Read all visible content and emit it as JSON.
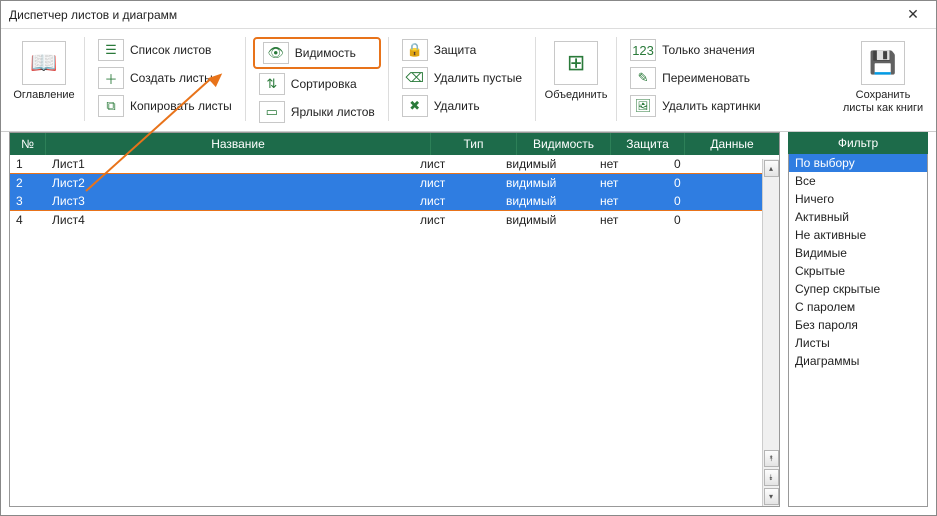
{
  "window": {
    "title": "Диспетчер листов и диаграмм"
  },
  "toolbar": {
    "toc": "Оглавление",
    "list_sheets": "Список листов",
    "create_sheets": "Создать листы",
    "copy_sheets": "Копировать листы",
    "visibility": "Видимость",
    "sort": "Сортировка",
    "tab_labels": "Ярлыки листов",
    "protection": "Защита",
    "delete_empty": "Удалить пустые",
    "delete": "Удалить",
    "merge": "Объединить",
    "values_only": "Только значения",
    "rename": "Переименовать",
    "delete_pictures": "Удалить картинки",
    "save_as_books": "Сохранить\nлисты как книги"
  },
  "table": {
    "headers": {
      "num": "№",
      "name": "Название",
      "type": "Тип",
      "visibility": "Видимость",
      "protection": "Защита",
      "data": "Данные"
    },
    "rows": [
      {
        "num": "1",
        "name": "Лист1",
        "type": "лист",
        "visibility": "видимый",
        "protection": "нет",
        "data": "0",
        "selected": false
      },
      {
        "num": "2",
        "name": "Лист2",
        "type": "лист",
        "visibility": "видимый",
        "protection": "нет",
        "data": "0",
        "selected": true
      },
      {
        "num": "3",
        "name": "Лист3",
        "type": "лист",
        "visibility": "видимый",
        "protection": "нет",
        "data": "0",
        "selected": true
      },
      {
        "num": "4",
        "name": "Лист4",
        "type": "лист",
        "visibility": "видимый",
        "protection": "нет",
        "data": "0",
        "selected": false
      }
    ]
  },
  "filter": {
    "title": "Фильтр",
    "items": [
      {
        "label": "По выбору",
        "selected": true
      },
      {
        "label": "Все"
      },
      {
        "label": "Ничего"
      },
      {
        "label": "Активный"
      },
      {
        "label": "Не активные"
      },
      {
        "label": "Видимые"
      },
      {
        "label": "Скрытые"
      },
      {
        "label": "Супер скрытые"
      },
      {
        "label": "С паролем"
      },
      {
        "label": "Без пароля"
      },
      {
        "label": "Листы"
      },
      {
        "label": "Диаграммы"
      }
    ]
  }
}
